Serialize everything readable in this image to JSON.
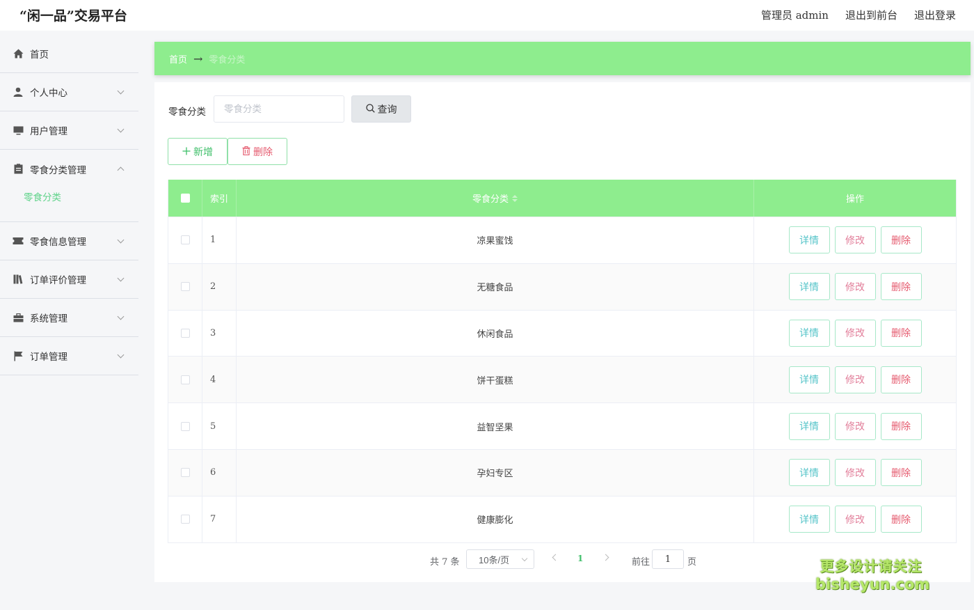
{
  "header": {
    "app_title": "“闲一品”交易平台",
    "links": [
      "管理员 admin",
      "退出到前台",
      "退出登录"
    ]
  },
  "sidebar": {
    "items": [
      {
        "label": "首页",
        "icon": "home-icon",
        "chevron": "none"
      },
      {
        "label": "个人中心",
        "icon": "user-icon",
        "chevron": "down"
      },
      {
        "label": "用户管理",
        "icon": "monitor-icon",
        "chevron": "down"
      },
      {
        "label": "零食分类管理",
        "icon": "clipboard-icon",
        "chevron": "up",
        "sub": [
          "零食分类"
        ]
      },
      {
        "label": "零食信息管理",
        "icon": "ticket-icon",
        "chevron": "down"
      },
      {
        "label": "订单评价管理",
        "icon": "book-icon",
        "chevron": "down"
      },
      {
        "label": "系统管理",
        "icon": "briefcase-icon",
        "chevron": "down"
      },
      {
        "label": "订单管理",
        "icon": "flag-icon",
        "chevron": "down"
      }
    ]
  },
  "breadcrumb": {
    "home": "首页",
    "arrow": "→",
    "current": "零食分类"
  },
  "search": {
    "label": "零食分类",
    "placeholder": "零食分类",
    "value": "",
    "query_label": "查询"
  },
  "actions": {
    "add_label": "新增",
    "delete_label": "删除"
  },
  "table": {
    "headers": {
      "index": "索引",
      "name": "零食分类",
      "ops": "操作"
    },
    "rows": [
      {
        "index": "1",
        "name": "凉果蜜饯"
      },
      {
        "index": "2",
        "name": "无糖食品"
      },
      {
        "index": "3",
        "name": "休闲食品"
      },
      {
        "index": "4",
        "name": "饼干蛋糕"
      },
      {
        "index": "5",
        "name": "益智坚果"
      },
      {
        "index": "6",
        "name": "孕妇专区"
      },
      {
        "index": "7",
        "name": "健康膨化"
      }
    ],
    "op_labels": {
      "detail": "详情",
      "edit": "修改",
      "delete": "删除"
    }
  },
  "pagination": {
    "total": "共 7 条",
    "page_size": "10条/页",
    "current": "1",
    "goto_label": "前往",
    "goto_value": "1",
    "page_suffix": "页"
  },
  "watermark": {
    "line1": "更多设计请关注",
    "line2": "bisheyun.com"
  },
  "colors": {
    "accent_green": "#8eed8e",
    "text_green": "#3fbf6a",
    "danger": "#e55a6e",
    "detail": "#56c4c9",
    "edit": "#e27e9a"
  }
}
